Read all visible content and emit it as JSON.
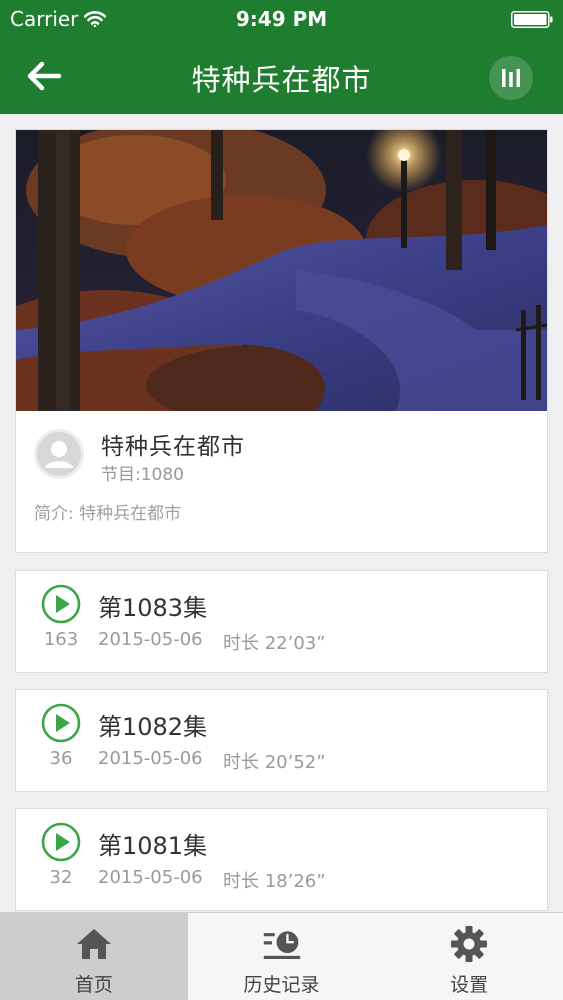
{
  "status_bar": {
    "carrier": "Carrier",
    "time": "9:49 PM",
    "wifi_icon": "wifi-icon",
    "battery_icon": "battery-icon"
  },
  "nav": {
    "title": "特种兵在都市",
    "back_icon": "back-arrow-icon",
    "player_icon": "equalizer-icon",
    "bg_color": "#1e7d2e"
  },
  "program": {
    "name": "特种兵在都市",
    "count": "节目:1080",
    "description": "简介: 特种兵在都市",
    "banner": "night-park-lamp-image",
    "avatar_icon": "user-avatar-icon"
  },
  "episodes": [
    {
      "title": "第1083集",
      "plays": "163",
      "date": "2015-05-06",
      "duration": "时长 22’03”"
    },
    {
      "title": "第1082集",
      "plays": "36",
      "date": "2015-05-06",
      "duration": "时长 20’52”"
    },
    {
      "title": "第1081集",
      "plays": "32",
      "date": "2015-05-06",
      "duration": "时长 18’26”"
    }
  ],
  "tabs": [
    {
      "label": "首页",
      "icon": "home-icon",
      "active": true
    },
    {
      "label": "历史记录",
      "icon": "history-icon",
      "active": false
    },
    {
      "label": "设置",
      "icon": "gear-icon",
      "active": false
    }
  ],
  "colors": {
    "accent_green": "#1e7d2e",
    "play_green": "#3aa648"
  }
}
